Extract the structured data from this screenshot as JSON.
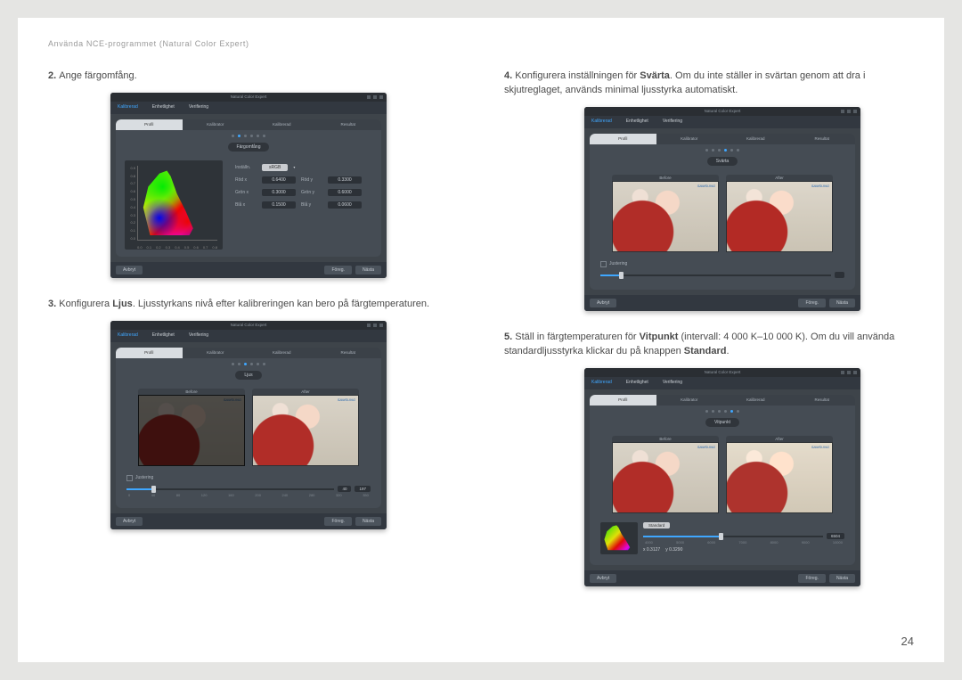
{
  "breadcrumb": "Använda NCE-programmet (Natural Color Expert)",
  "page_number": "24",
  "app_title": "Natural Color Expert",
  "main_tabs": [
    "Kalibrerad",
    "Enhetlighet",
    "Verifiering"
  ],
  "sub_tabs": [
    "Profil",
    "Kalibrator",
    "Kalibrerad",
    "Resultat"
  ],
  "footer": {
    "cancel": "Avbryt",
    "prev": "Föreg.",
    "next": "Nästa"
  },
  "preview": {
    "before": "Before",
    "after": "After",
    "logo": "SAMSUNG"
  },
  "step2": {
    "text_num": "2.",
    "text": "Ange färgomfång.",
    "badge": "Färgomfång",
    "gamut_select_label": "Inställn.",
    "gamut_select_value": "sRGB",
    "yticks": [
      "0.9",
      "0.8",
      "0.7",
      "0.6",
      "0.5",
      "0.4",
      "0.3",
      "0.2",
      "0.1",
      "0.0"
    ],
    "xticks": [
      "0.0",
      "0.1",
      "0.2",
      "0.3",
      "0.4",
      "0.5",
      "0.6",
      "0.7",
      "0.8"
    ],
    "rows": [
      {
        "l": "Röd x",
        "v": "0.6400",
        "l2": "Röd y",
        "v2": "0.3300"
      },
      {
        "l": "Grön x",
        "v": "0.3000",
        "l2": "Grön y",
        "v2": "0.6000"
      },
      {
        "l": "Blå x",
        "v": "0.1500",
        "l2": "Blå y",
        "v2": "0.0600"
      }
    ]
  },
  "step3": {
    "text_num": "3.",
    "text_a": "Konfigurera ",
    "text_bold": "Ljus",
    "text_b": ". Ljusstyrkans nivå efter kalibreringen kan bero på färgtemperaturen.",
    "badge": "Ljus",
    "check": "Justering",
    "ticks": [
      "0",
      "40",
      "80",
      "120",
      "160",
      "200",
      "240",
      "280",
      "320",
      "350"
    ],
    "val1": "40",
    "val2": "197"
  },
  "step4": {
    "text_num": "4.",
    "text_a": "Konfigurera inställningen för ",
    "text_bold": "Svärta",
    "text_b": ". Om du inte ställer in svärtan genom att dra i skjutreglaget, används minimal ljusstyrka automatiskt.",
    "badge": "Svärta",
    "check": "Justering"
  },
  "step5": {
    "text_num": "5.",
    "text_a": "Ställ in färgtemperaturen för ",
    "text_bold1": "Vitpunkt",
    "text_b": " (intervall: 4 000 K–10 000 K). Om du vill använda standardljusstyrka klickar du på knappen ",
    "text_bold2": "Standard",
    "text_c": ".",
    "badge": "Vitpunkt",
    "std_btn": "Standard",
    "ticks": [
      "4000",
      "5000",
      "6000",
      "7000",
      "8000",
      "9000",
      "10000"
    ],
    "val": "6504",
    "coord_x": "x 0.3127",
    "coord_y": "y 0.3290"
  }
}
